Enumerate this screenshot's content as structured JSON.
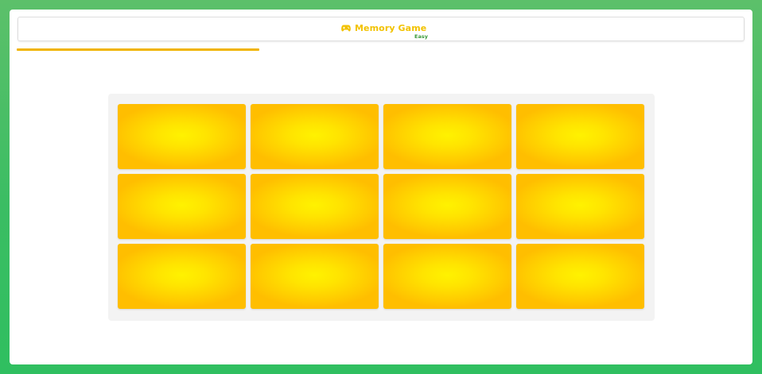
{
  "header": {
    "title": "Memory Game",
    "difficulty": "Easy",
    "icon": "gamepad-icon"
  },
  "progress": {
    "fraction": 0.333
  },
  "board": {
    "rows": 3,
    "columns": 4,
    "cards": [
      {
        "state": "face-down"
      },
      {
        "state": "face-down"
      },
      {
        "state": "face-down"
      },
      {
        "state": "face-down"
      },
      {
        "state": "face-down"
      },
      {
        "state": "face-down"
      },
      {
        "state": "face-down"
      },
      {
        "state": "face-down"
      },
      {
        "state": "face-down"
      },
      {
        "state": "face-down"
      },
      {
        "state": "face-down"
      },
      {
        "state": "face-down"
      }
    ]
  },
  "colors": {
    "background_green": "#3bbd63",
    "accent_yellow": "#f2c200",
    "progress": "#f0b400",
    "difficulty_green": "#3a9a3a",
    "card_center": "#fff200",
    "card_edge": "#ffbe00"
  }
}
